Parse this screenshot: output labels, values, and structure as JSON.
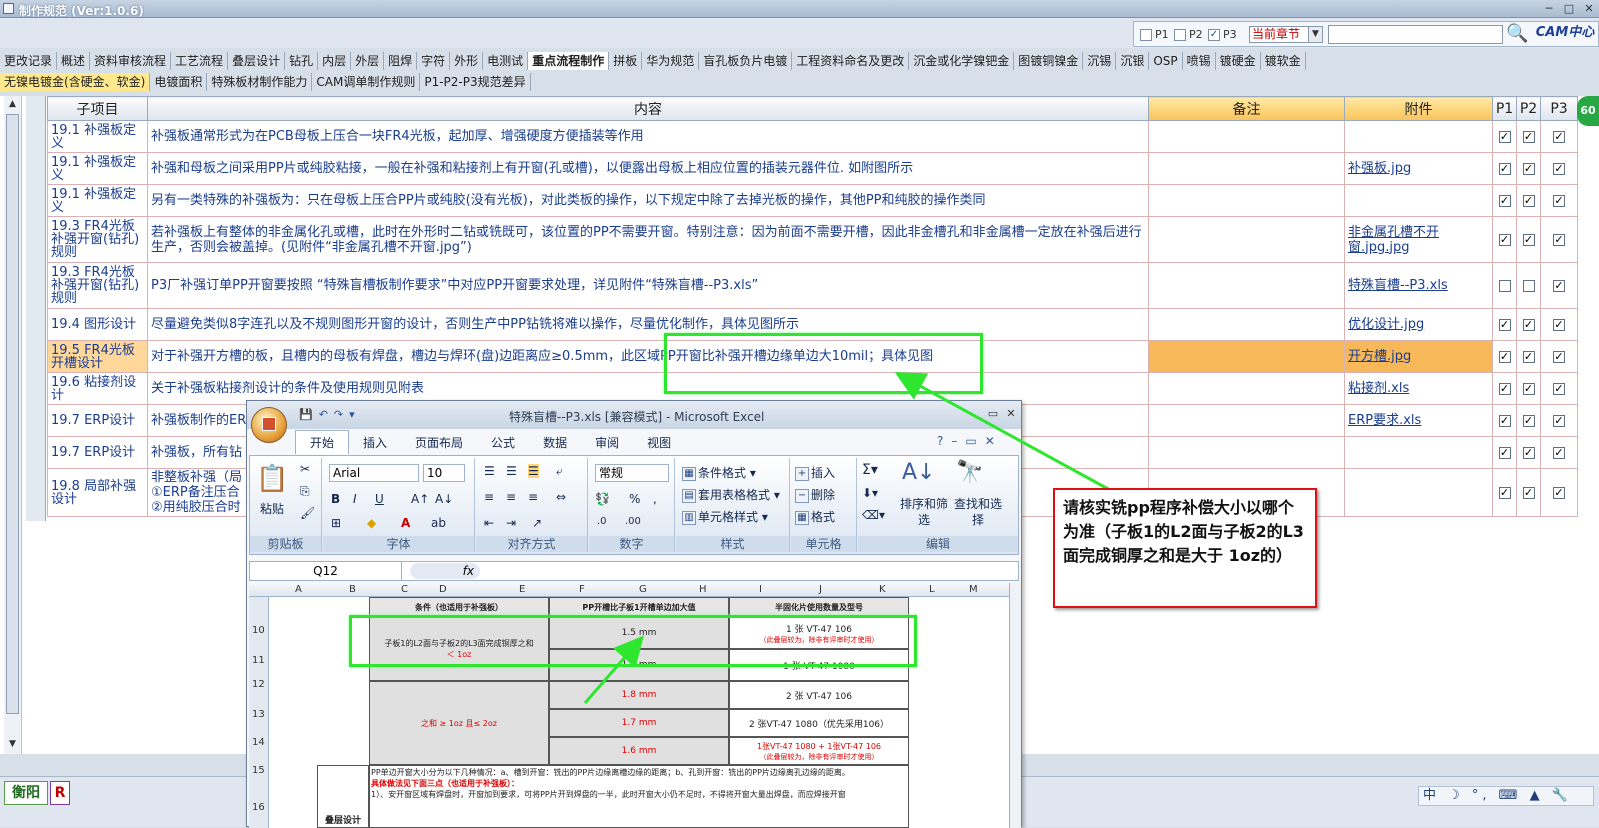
{
  "window": {
    "title": "制作规范 (Ver:1.0.6)"
  },
  "toolbar": {
    "filters": [
      {
        "label": "P1",
        "checked": false
      },
      {
        "label": "P2",
        "checked": false
      },
      {
        "label": "P3",
        "checked": true
      }
    ],
    "chapter_select": "当前章节",
    "search_value": "",
    "logo": "CAM中心"
  },
  "tabs_row1": [
    "更改记录",
    "概述",
    "资料审核流程",
    "工艺流程",
    "叠层设计",
    "钻孔",
    "内层",
    "外层",
    "阻焊",
    "字符",
    "外形",
    "电测试",
    "重点流程制作",
    "拼板",
    "华为规范",
    "盲孔板负片电镀",
    "工程资料命名及更改",
    "沉金或化学镍钯金",
    "图镀铜镍金",
    "沉锡",
    "沉银",
    "OSP",
    "喷锡",
    "镀硬金",
    "镀软金"
  ],
  "tabs_row1_active": 12,
  "tabs_row2": [
    "无镍电镀金(含硬金、软金)",
    "电镀面积",
    "特殊板材制作能力",
    "CAM调单制作规则",
    "P1-P2-P3规范差异"
  ],
  "table": {
    "headers": {
      "sub": "子项目",
      "content": "内容",
      "remark": "备注",
      "attach": "附件",
      "p1": "P1",
      "p2": "P2",
      "p3": "P3"
    },
    "rows": [
      {
        "sub": "19.1 补强板定义",
        "content": "补强板通常形式为在PCB母板上压合一块FR4光板，起加厚、增强硬度方便插装等作用",
        "remark": "",
        "attach": "",
        "p1": true,
        "p2": true,
        "p3": true
      },
      {
        "sub": "19.1 补强板定义",
        "content": "补强和母板之间采用PP片或纯胶粘接，一般在补强和粘接剂上有开窗(孔或槽)，以便露出母板上相应位置的插装元器件位. 如附图所示",
        "remark": "",
        "attach": "补强板.jpg",
        "p1": true,
        "p2": true,
        "p3": true
      },
      {
        "sub": "19.1 补强板定义",
        "content": "另有一类特殊的补强板为：只在母板上压合PP片或纯胶(没有光板)，对此类板的操作，以下规定中除了去掉光板的操作，其他PP和纯胶的操作类同",
        "remark": "",
        "attach": "",
        "p1": true,
        "p2": true,
        "p3": true
      },
      {
        "sub": "19.3 FR4光板补强开窗(钻孔)规则",
        "content": "若补强板上有整体的非金属化孔或槽，此时在外形时二钻或铣既可，该位置的PP不需要开窗。特别注意：因为前面不需要开槽，因此非金槽孔和非金属槽一定放在补强后进行生产，否则会被盖掉。(见附件“非金属孔槽不开窗.jpg”)",
        "remark": "",
        "attach": "非金属孔槽不开窗.jpg.jpg",
        "p1": true,
        "p2": true,
        "p3": true
      },
      {
        "sub": "19.3 FR4光板补强开窗(钻孔)规则",
        "content": "P3厂补强订单PP开窗要按照 “特殊盲槽板制作要求”中对应PP开窗要求处理，详见附件“特殊盲槽--P3.xls”",
        "remark": "",
        "attach": "特殊盲槽--P3.xls",
        "p1": false,
        "p2": false,
        "p3": true
      },
      {
        "sub": "19.4 图形设计",
        "content": "尽量避免类似8字连孔以及不规则图形开窗的设计，否则生产中PP钻铣将难以操作，尽量优化制作，具体见图所示",
        "remark": "",
        "attach": "优化设计.jpg",
        "p1": true,
        "p2": true,
        "p3": true
      },
      {
        "sub": "19.5 FR4光板开槽设计",
        "content": "对于补强开方槽的板，且槽内的母板有焊盘，槽边与焊环(盘)边距离应≥0.5mm，此区域PP开窗比补强开槽边缘单边大10mil；具体见图",
        "remark": "",
        "attach": "开方槽.jpg",
        "p1": true,
        "p2": true,
        "p3": true,
        "selected": true
      },
      {
        "sub": "19.6 粘接剂设计",
        "content": "关于补强板粘接剂设计的条件及使用规则见附表",
        "remark": "",
        "attach": "粘接剂.xls",
        "p1": true,
        "p2": true,
        "p3": true
      },
      {
        "sub": "19.7 ERP设计",
        "content": "补强板制作的ERP",
        "remark": "",
        "attach": "ERP要求.xls",
        "p1": true,
        "p2": true,
        "p3": true
      },
      {
        "sub": "19.7 ERP设计",
        "content": "补强板，所有钻",
        "remark": "",
        "attach": "",
        "p1": true,
        "p2": true,
        "p3": true
      },
      {
        "sub": "19.8 局部补强设计",
        "content": "非整板补强（局\n①ERP备注压合\n②用纯胶压合时",
        "remark": "",
        "attach": "",
        "p1": true,
        "p2": true,
        "p3": true
      }
    ]
  },
  "badge": "60",
  "statusbar": {
    "city": "衡阳",
    "r": "R",
    "tray": "中 ☽ °, ⌨ ▲ 🔧"
  },
  "excel": {
    "title": "特殊盲槽--P3.xls [兼容模式] - Microsoft Excel",
    "ribbon_tabs": [
      "开始",
      "插入",
      "页面布局",
      "公式",
      "数据",
      "审阅",
      "视图"
    ],
    "groups": {
      "clipboard": "剪贴板",
      "font": "字体",
      "align": "对齐方式",
      "number": "数字",
      "styles": "样式",
      "cells": "单元格",
      "edit": "编辑"
    },
    "paste": "粘贴",
    "font_name": "Arial",
    "font_size": "10",
    "number_format": "常规",
    "styles": [
      "条件格式",
      "套用表格格式",
      "单元格样式"
    ],
    "cells": [
      "插入",
      "删除",
      "格式"
    ],
    "edit": [
      "排序和筛选",
      "查找和选择"
    ],
    "name_box": "Q12",
    "fx": "fx",
    "columns": [
      "A",
      "B",
      "C",
      "D",
      "E",
      "F",
      "G",
      "H",
      "I",
      "J",
      "K",
      "L",
      "M"
    ],
    "rows": [
      "10",
      "11",
      "12",
      "13",
      "14",
      "15",
      "16"
    ],
    "sheet": {
      "h_cond": "条件（也适用于补强板）",
      "h_pp": "PP开槽比子板1开槽单边加大值",
      "h_semi": "半固化片使用数量及型号",
      "cond1": "子板1的L2面与子板2的L3面完成铜厚之和",
      "cond1b": "＜ 1oz",
      "v1": "1.5 mm",
      "s1": "1 张 VT-47 106",
      "s1n": "（此叠层较为，除非有评审时才使用）",
      "v2": "1.4 mm",
      "s2": "1 张 VT-47 1080",
      "v3": "1.8 mm",
      "s3": "2 张 VT-47 106",
      "cond2": "之和 ≥ 1oz 且≤ 2oz",
      "v4": "1.7 mm",
      "s4": "2 张VT-47 1080（优先采用106）",
      "v5": "1.6 mm",
      "s5": "1张VT-47 1080 + 1张VT-47 106",
      "s5n": "（此叠层较为，除非有评审时才使用）",
      "stack": "叠层设计",
      "note1": "PP单边开窗大小分为以下几种情况：a、槽到开窗：铣出的PP片边缘离槽边缘的距离；b、孔到开窗：铣出的PP片边缘离孔边缘的距离。",
      "note2": "具体做法见下面三点（也适用于补强板）：",
      "note3": "1）、安开窗区域有焊盘时，开窗加到要求，可将PP片开到焊盘的一半，此时开窗大小仍不足时，不得将开窗大量出焊盘，而应焊接开窗"
    }
  },
  "callout": "请核实铣pp程序补偿大小以哪个为准（子板1的L2面与子板2的L3面完成铜厚之和是大于 1oz的）"
}
